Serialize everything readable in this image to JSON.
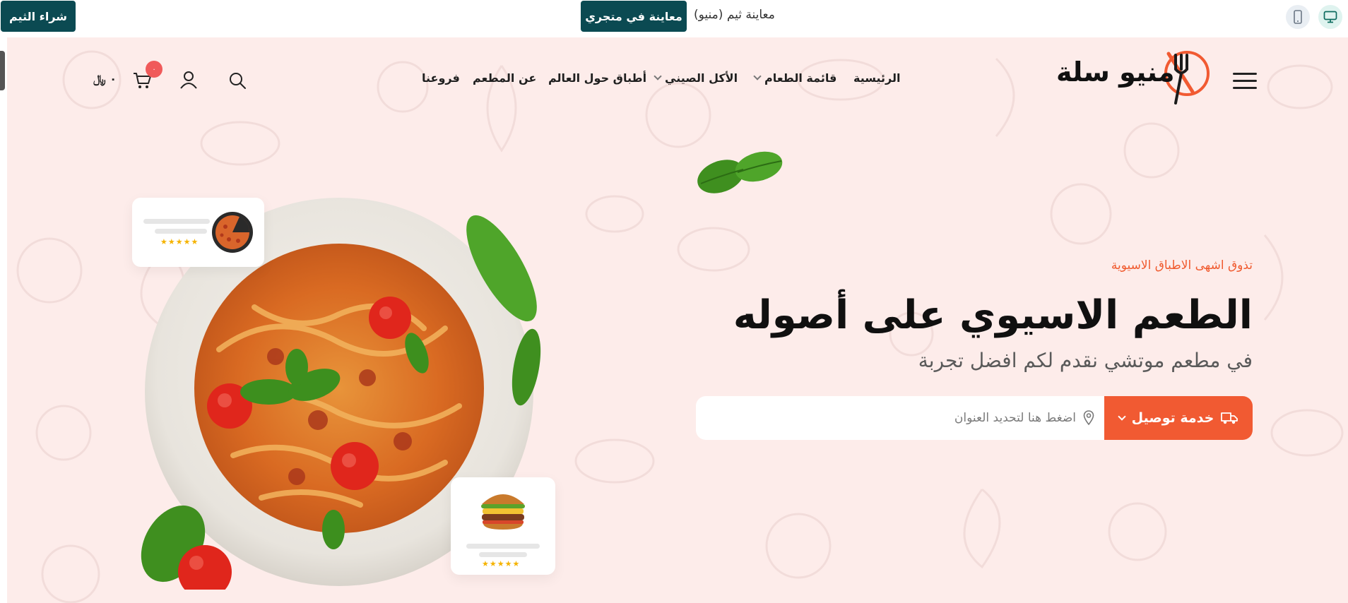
{
  "preview_bar": {
    "buy_theme_label": "شراء الثيم",
    "preview_store_label": "معاينة في متجري",
    "theme_preview_text": "معاينة ثيم (منيو)",
    "device_icons": [
      "desktop-icon",
      "mobile-icon"
    ]
  },
  "header": {
    "logo_text": "منيو سلة",
    "nav": [
      {
        "label": "الرئيسية",
        "has_dropdown": false
      },
      {
        "label": "قائمة الطعام",
        "has_dropdown": true
      },
      {
        "label": "الأكل الصيني",
        "has_dropdown": true
      },
      {
        "label": "أطباق حول العالم",
        "has_dropdown": false
      },
      {
        "label": "عن المطعم",
        "has_dropdown": false
      },
      {
        "label": "فروعنا",
        "has_dropdown": false
      }
    ],
    "cart_count": "٠",
    "cart_total": "٠ ﷼",
    "icons": [
      "search-icon",
      "user-icon",
      "cart-icon"
    ]
  },
  "hero": {
    "tagline": "تذوق اشهى الاطباق الاسيوية",
    "headline": "الطعم الاسيوي على أصوله",
    "subline": "في مطعم موتشي نقدم لكم افضل تجربة",
    "delivery_label": "خدمة توصيل",
    "address_placeholder": "اضغط هنا لتحديد العنوان",
    "pizza_card_stars": "★★★★★",
    "burger_card_stars": "★★★★★"
  },
  "colors": {
    "accent": "#f15a32",
    "brand_dark": "#0b4a52",
    "hero_bg": "#fdecea",
    "badge": "#f05a5a"
  }
}
